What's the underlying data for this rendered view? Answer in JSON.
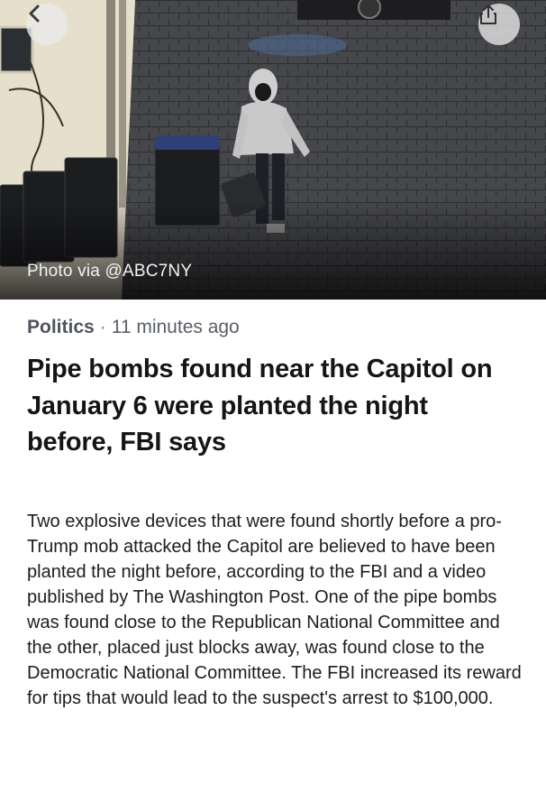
{
  "hero": {
    "credit": "Photo via @ABC7NY",
    "description": "Surveillance still of a hooded person carrying a bag past trash bins in an alley at night"
  },
  "nav": {
    "back_icon": "chevron-left-icon",
    "share_icon": "share-icon"
  },
  "article": {
    "category": "Politics",
    "separator": "·",
    "timestamp": "11 minutes ago",
    "headline": "Pipe bombs found near the Capitol on January 6 were planted the night before, FBI says",
    "summary": "Two explosive devices that were found shortly before a pro-Trump mob attacked the Capitol are believed to have been planted the night before, according to the FBI and a video published by The Washington Post. One of the pipe bombs was found close to the Republican National Committee and the other, placed just blocks away, was found close to the Democratic National Committee. The FBI increased its reward for tips that would lead to the suspect's arrest to $100,000."
  },
  "colors": {
    "meta_text": "#5a5e66",
    "headline_text": "#151515",
    "body_text": "#1d1d1f",
    "button_bg": "#ebebeb"
  }
}
